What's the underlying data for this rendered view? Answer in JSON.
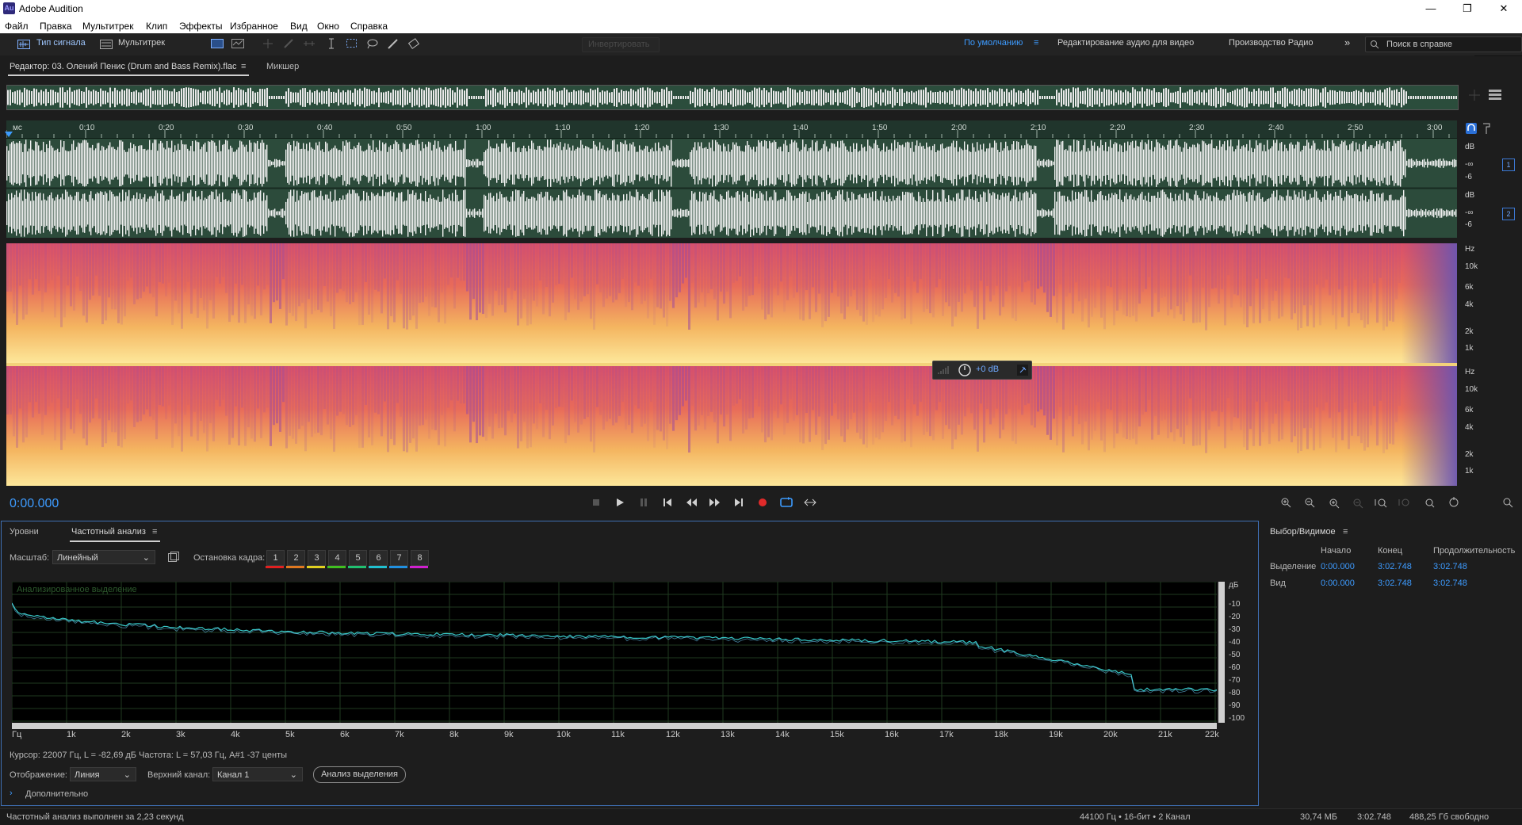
{
  "app": {
    "title": "Adobe Audition",
    "icon_text": "Au"
  },
  "window_controls": {
    "minimize": "—",
    "maximize": "❐",
    "close": "✕"
  },
  "menu": [
    "Файл",
    "Правка",
    "Мультитрек",
    "Клип",
    "Эффекты",
    "Избранное",
    "Вид",
    "Окно",
    "Справка"
  ],
  "toolbar": {
    "waveform_view": "Тип сигнала",
    "multitrack_view": "Мультитрек",
    "invert": "Инвертировать",
    "workspaces": [
      "По умолчанию",
      "Редактирование аудио для видео",
      "Производство Радио"
    ],
    "more": "»",
    "search_placeholder": "Поиск в справке"
  },
  "editor": {
    "tab_editor": "Редактор: 03. Олений Пенис (Drum and Bass Remix).flac",
    "tab_mixer": "Микшер"
  },
  "ruler": {
    "start_label": "мс",
    "ticks": [
      "0:10",
      "0:20",
      "0:30",
      "0:40",
      "0:50",
      "1:00",
      "1:10",
      "1:20",
      "1:30",
      "1:40",
      "1:50",
      "2:00",
      "2:10",
      "2:20",
      "2:30",
      "2:40",
      "2:50",
      "3:00"
    ]
  },
  "waveform_axis": {
    "ch1": [
      "dB",
      "-∞",
      "-6"
    ],
    "ch2": [
      "dB",
      "-∞",
      "-6"
    ],
    "ch1_badge": "1",
    "ch2_badge": "2"
  },
  "spectral_axis": {
    "ch1": [
      "Hz",
      "10k",
      "6k",
      "4k",
      "2k",
      "1k"
    ],
    "ch2": [
      "Hz",
      "10k",
      "6k",
      "4k",
      "2k",
      "1k"
    ]
  },
  "hud": {
    "volume": "+0 dB"
  },
  "transport": {
    "time": "0:00.000"
  },
  "freq_panel": {
    "tab_levels": "Уровни",
    "tab_freq": "Частотный анализ",
    "scale_label": "Масштаб:",
    "scale_value": "Линейный",
    "freeze_label": "Остановка кадра:",
    "slots": [
      "1",
      "2",
      "3",
      "4",
      "5",
      "6",
      "7",
      "8"
    ],
    "slot_colors": [
      "#e02020",
      "#e07820",
      "#e0d020",
      "#40c020",
      "#20c070",
      "#20c0d0",
      "#2090e0",
      "#d020d0"
    ],
    "graph_title": "Анализированное выделение",
    "db_ticks": [
      "дБ",
      "-10",
      "-20",
      "-30",
      "-40",
      "-50",
      "-60",
      "-70",
      "-80",
      "-90",
      "-100"
    ],
    "freq_ticks": [
      "Гц",
      "1k",
      "2k",
      "3k",
      "4k",
      "5k",
      "6k",
      "7k",
      "8k",
      "9k",
      "10k",
      "11k",
      "12k",
      "13k",
      "14k",
      "15k",
      "16k",
      "17k",
      "18k",
      "19k",
      "20k",
      "21k",
      "22k"
    ],
    "cursor_text": "Курсор: 22007 Гц, L = -82,69 дБ Частота: L = 57,03 Гц, A#1 -37 центы",
    "display_label": "Отображение:",
    "display_value": "Линия",
    "channel_label": "Верхний канал:",
    "channel_value": "Канал 1",
    "analyze_button": "Анализ выделения",
    "advanced": "Дополнительно",
    "line_color": "#38c8c8"
  },
  "selection_panel": {
    "title": "Выбор/Видимое",
    "headers": [
      "Начало",
      "Конец",
      "Продолжительность"
    ],
    "rows": [
      {
        "label": "Выделение",
        "start": "0:00.000",
        "end": "3:02.748",
        "duration": "3:02.748"
      },
      {
        "label": "Вид",
        "start": "0:00.000",
        "end": "3:02.748",
        "duration": "3:02.748"
      }
    ]
  },
  "status": {
    "message": "Частотный анализ выполнен за 2,23 секунд",
    "format": "44100 Гц • 16-бит • 2 Канал",
    "size": "30,74 МБ",
    "duration": "3:02.748",
    "free": "488,25 Гб свободно"
  }
}
